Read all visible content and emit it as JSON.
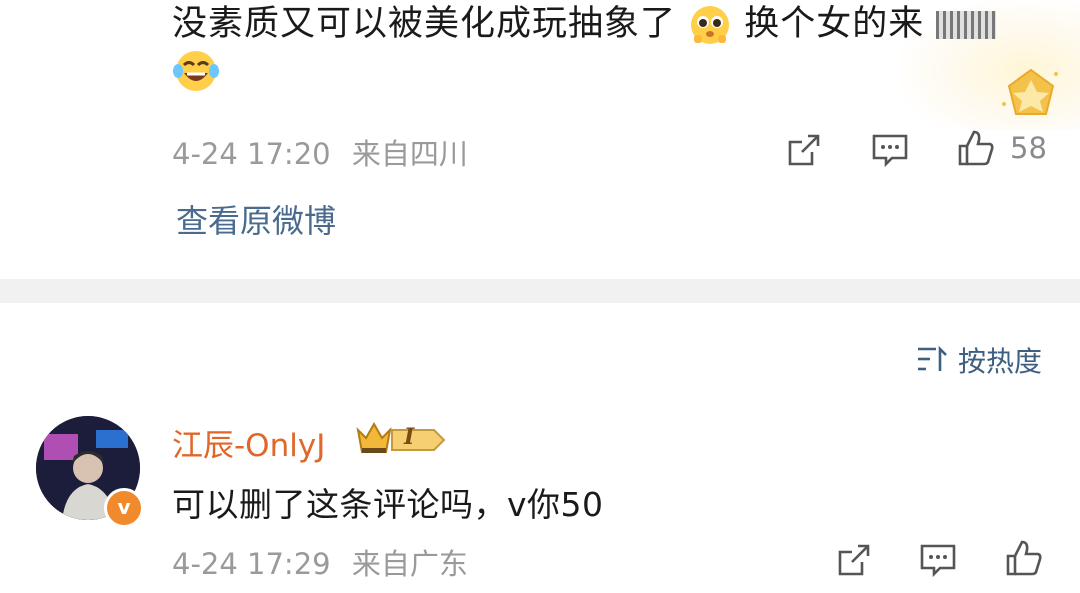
{
  "post": {
    "text": "没素质又可以被美化成玩抽象了",
    "text_after_emoji": "换个女的来",
    "emojis": [
      "pleading-face-icon",
      "laughing-tears-icon"
    ],
    "time": "4-24 17:20",
    "location": "来自四川",
    "like_count": "58",
    "view_original": "查看原微博"
  },
  "sort": {
    "label": "按热度"
  },
  "comment": {
    "username": "江辰-OnlyJ",
    "badge_level": "I",
    "verified_mark": "v",
    "text": "可以删了这条评论吗，v你50",
    "time": "4-24 17:29",
    "location": "来自广东"
  },
  "colors": {
    "username": "#e0672a",
    "link": "#4a6b8d",
    "meta": "#9a9a9a",
    "verified": "#f1892d",
    "divider": "#f1f1f1"
  }
}
